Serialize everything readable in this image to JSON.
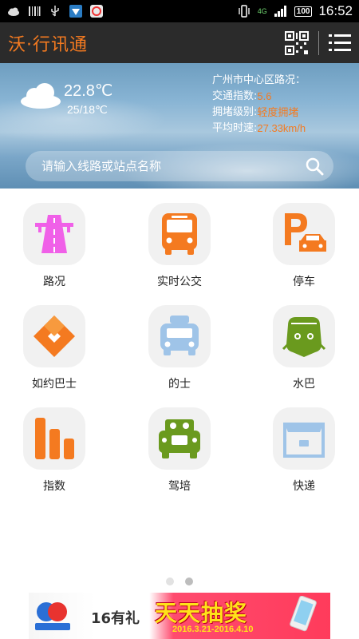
{
  "status_bar": {
    "network_label": "4G",
    "battery": "100",
    "time": "16:52"
  },
  "app_bar": {
    "title": "沃·行讯通"
  },
  "weather": {
    "temperature": "22.8℃",
    "range": "25/18℃",
    "icon": "cloud-icon"
  },
  "traffic": {
    "heading": "广州市中心区路况：",
    "rows": [
      {
        "label": "交通指数:",
        "value": "5.6"
      },
      {
        "label": "拥堵级别:",
        "value": "轻度拥堵"
      },
      {
        "label": "平均时速:",
        "value": "27.33km/h"
      }
    ]
  },
  "search": {
    "placeholder": "请输入线路或站点名称"
  },
  "grid": {
    "items": [
      {
        "label": "路况",
        "icon": "road-icon"
      },
      {
        "label": "实时公交",
        "icon": "bus-icon"
      },
      {
        "label": "停车",
        "icon": "parking-icon"
      },
      {
        "label": "如约巴士",
        "icon": "diamond-icon"
      },
      {
        "label": "的士",
        "icon": "taxi-icon"
      },
      {
        "label": "水巴",
        "icon": "ferry-icon"
      },
      {
        "label": "指数",
        "icon": "bars-icon"
      },
      {
        "label": "驾培",
        "icon": "driving-school-icon"
      },
      {
        "label": "快递",
        "icon": "package-icon"
      }
    ]
  },
  "pager": {
    "count": 2,
    "active": 2
  },
  "ad": {
    "gift": "16有礼",
    "headline": "天天抽奖",
    "date": "2016.3.21-2016.4.10"
  },
  "colors": {
    "accent": "#f47a20",
    "road": "#f060e8",
    "green": "#6a9a1e",
    "blue": "#9fc4e8",
    "orange": "#f47a20"
  }
}
